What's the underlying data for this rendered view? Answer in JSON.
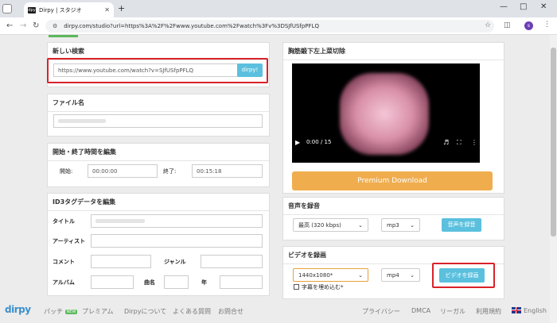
{
  "browser": {
    "tab_title": "Dirpy | スタジオ",
    "tab_favicon": "dpy",
    "close_tab": "✕",
    "new_tab": "+",
    "url": "dirpy.com/studio?url=https%3A%2F%2Fwww.youtube.com%2Fwatch%3Fv%3DSJfUSfpPFLQ",
    "avatar_letter": "s"
  },
  "search": {
    "title": "新しい検索",
    "value": "https://www.youtube.com/watch?v=SJfUSfpPFLQ",
    "button": "dirpy!"
  },
  "filename": {
    "title": "ファイル名"
  },
  "time": {
    "title": "開始・終了時間を編集",
    "start_label": "開始:",
    "start_value": "00:00:00",
    "end_label": "終了:",
    "end_value": "00:15:18"
  },
  "id3": {
    "title": "ID3タグデータを編集",
    "title_label": "タイトル",
    "artist_label": "アーティスト",
    "comment_label": "コメント",
    "genre_label": "ジャンル",
    "album_label": "アルバム",
    "track_label": "曲名",
    "year_label": "年"
  },
  "video": {
    "title": "胸筋鍛下左上菜切除",
    "time": "0:00 / 15"
  },
  "premium": "Premium Download",
  "audio": {
    "title": "音声を録音",
    "quality": "最高 (320 kbps)",
    "format": "mp3",
    "button": "音声を録音"
  },
  "videorec": {
    "title": "ビデオを録画",
    "resolution": "1440x1080*",
    "format": "mp4",
    "button": "ビデオを録画",
    "subtitle_label": "字幕を埋め込む*"
  },
  "footer": {
    "logo": "dirpy",
    "patch": "パッチ",
    "patch_badge": "NEW",
    "premium": "プレミアム",
    "about": "Dirpyについて",
    "faq": "よくある質問",
    "contact": "お問合せ",
    "privacy": "プライバシー",
    "dmca": "DMCA",
    "legal": "リーガル",
    "terms": "利用規約",
    "language": "English"
  },
  "colors": {
    "accent_blue": "#5bc0de",
    "premium_orange": "#f0ad4e",
    "highlight_red": "#d9222a",
    "logo_blue": "#3d8fcc"
  }
}
